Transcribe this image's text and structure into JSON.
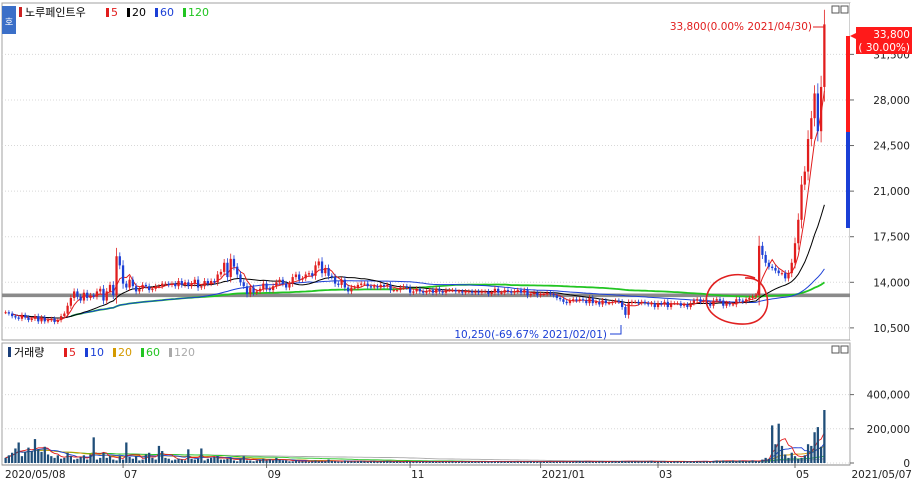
{
  "price_panel": {
    "legend": {
      "stock_name": "노루페인트우",
      "ma_items": [
        {
          "label": "5",
          "color": "#e11d1d"
        },
        {
          "label": "20",
          "color": "#000000"
        },
        {
          "label": "60",
          "color": "#1b3fd6"
        },
        {
          "label": "120",
          "color": "#22c522"
        }
      ]
    },
    "side_tab": "호",
    "y_ticks": [
      "31,500",
      "28,000",
      "24,500",
      "21,000",
      "17,500",
      "14,000",
      "10,500"
    ],
    "current_price_label": {
      "price": "33,800",
      "change": "( 30.00%)",
      "color": "#ff1a1a"
    },
    "high_annotation": "33,800(0.00% 2021/04/30)",
    "low_annotation": "10,250(-69.67% 2021/02/01)",
    "reference_line_value": 13000
  },
  "volume_panel": {
    "legend": {
      "title": "거래량",
      "ma_items": [
        {
          "label": "5",
          "color": "#e11d1d"
        },
        {
          "label": "10",
          "color": "#1b3fd6"
        },
        {
          "label": "20",
          "color": "#d49a00"
        },
        {
          "label": "60",
          "color": "#22c522"
        },
        {
          "label": "120",
          "color": "#aaaaaa"
        }
      ]
    },
    "y_ticks": [
      "400,000",
      "200,000",
      "0"
    ]
  },
  "x_axis": {
    "labels": [
      "2020/05/08",
      "07",
      "09",
      "11",
      "2021/01",
      "03",
      "05",
      "2021/05/07"
    ]
  },
  "chart_data": {
    "type": "candlestick",
    "period": "2020/05/08 - 2021/05/07",
    "price_axis": {
      "ylim": [
        9800,
        34600
      ],
      "ticks": [
        10500,
        14000,
        17500,
        21000,
        24500,
        28000,
        31500
      ]
    },
    "volume_axis": {
      "ylim": [
        0,
        620000
      ],
      "ticks": [
        0,
        200000,
        400000
      ]
    },
    "high": {
      "value": 33800,
      "date": "2021/04/30"
    },
    "low": {
      "value": 10250,
      "date": "2021/02/01"
    },
    "last": {
      "value": 33800,
      "change_pct": 30.0
    },
    "close_series": [
      11700,
      11600,
      11400,
      11300,
      11200,
      11500,
      11300,
      11100,
      11200,
      11400,
      11000,
      11300,
      11000,
      11100,
      11200,
      10950,
      11100,
      11400,
      11600,
      12200,
      12800,
      13300,
      12900,
      12600,
      13200,
      12800,
      13000,
      12900,
      13300,
      13500,
      12600,
      13300,
      13800,
      13000,
      16000,
      15300,
      13900,
      13600,
      14200,
      13700,
      13300,
      13500,
      13800,
      13700,
      13400,
      13500,
      13700,
      13700,
      13900,
      13900,
      13800,
      13900,
      13700,
      14100,
      13800,
      14000,
      13700,
      13900,
      14200,
      13600,
      13700,
      14100,
      13900,
      14100,
      14000,
      14600,
      14800,
      15500,
      14400,
      15800,
      15200,
      14600,
      14000,
      13700,
      13100,
      13600,
      13200,
      13300,
      13500,
      13900,
      13500,
      13400,
      13700,
      14000,
      14200,
      13900,
      13600,
      13900,
      14400,
      14600,
      14200,
      14300,
      14600,
      14700,
      14500,
      15300,
      15600,
      14700,
      15100,
      14500,
      14400,
      13900,
      13800,
      14200,
      13600,
      13300,
      13600,
      13600,
      13800,
      13900,
      13900,
      13700,
      13600,
      13700,
      13600,
      13800,
      13700,
      13800,
      13400,
      13400,
      13400,
      13600,
      13700,
      13600,
      13200,
      13300,
      13500,
      13300,
      13200,
      13300,
      13400,
      13200,
      13500,
      13300,
      13200,
      13400,
      13400,
      13400,
      13300,
      13300,
      13200,
      13300,
      13300,
      13200,
      13300,
      13200,
      13300,
      13300,
      13100,
      13200,
      13500,
      13200,
      13200,
      13400,
      13300,
      13200,
      13300,
      13400,
      13200,
      13400,
      13000,
      13100,
      13200,
      13000,
      13100,
      13100,
      13200,
      13100,
      13000,
      12800,
      12700,
      12500,
      12400,
      12600,
      12700,
      12600,
      12700,
      12600,
      12400,
      12800,
      12400,
      12500,
      12300,
      12600,
      12400,
      12400,
      12500,
      12600,
      12500,
      12100,
      11500,
      12400,
      12500,
      12500,
      12400,
      12500,
      12400,
      12300,
      12400,
      12100,
      12400,
      12300,
      12500,
      12100,
      12400,
      12400,
      12400,
      12200,
      12300,
      12100,
      12400,
      12600,
      12700,
      12500,
      12600,
      12400,
      12200,
      12600,
      12700,
      12600,
      12200,
      12400,
      12300,
      12300,
      12700,
      12600,
      12500,
      12700,
      12800,
      12900,
      13000,
      16800,
      16100,
      15500,
      15200,
      15100,
      14900,
      14700,
      14700,
      14300,
      14700,
      15500,
      17000,
      18800,
      21500,
      22500,
      25000,
      26600,
      28500,
      25600,
      29000,
      33800
    ],
    "volume_series": [
      30000,
      45000,
      60000,
      85000,
      120000,
      40000,
      65000,
      90000,
      70000,
      140000,
      80000,
      65000,
      95000,
      50000,
      40000,
      30000,
      45000,
      25000,
      30000,
      60000,
      40000,
      20000,
      25000,
      35000,
      45000,
      20000,
      50000,
      150000,
      20000,
      30000,
      60000,
      30000,
      40000,
      20000,
      15000,
      40000,
      20000,
      120000,
      35000,
      25000,
      40000,
      15000,
      20000,
      50000,
      60000,
      30000,
      20000,
      100000,
      70000,
      30000,
      25000,
      15000,
      20000,
      25000,
      20000,
      15000,
      80000,
      25000,
      20000,
      25000,
      85000,
      15000,
      25000,
      30000,
      35000,
      40000,
      20000,
      20000,
      25000,
      30000,
      15000,
      10000,
      25000,
      40000,
      15000,
      15000,
      10000,
      15000,
      20000,
      25000,
      15000,
      20000,
      15000,
      30000,
      20000,
      15000,
      15000,
      10000,
      10000,
      15000,
      10000,
      10000,
      10000,
      8000,
      10000,
      15000,
      10000,
      10000,
      10000,
      20000,
      12000,
      10000,
      8000,
      8000,
      15000,
      10000,
      10000,
      10000,
      10000,
      12000,
      10000,
      8000,
      10000,
      10000,
      8000,
      10000,
      10000,
      12000,
      10000,
      8000,
      10000,
      8000,
      8000,
      10000,
      10000,
      8000,
      10000,
      8000,
      10000,
      8000,
      10000,
      10000,
      8000,
      8000,
      10000,
      8000,
      8000,
      10000,
      8000,
      8000,
      8000,
      8000,
      8000,
      8000,
      8000,
      8000,
      8000,
      8000,
      8000,
      8000,
      8000,
      8000,
      8000,
      8000,
      8000,
      8000,
      8000,
      8000,
      8000,
      8000,
      8000,
      10000,
      8000,
      8000,
      8000,
      8000,
      8000,
      8000,
      8000,
      8000,
      8000,
      8000,
      8000,
      8000,
      8000,
      10000,
      12000,
      10000,
      10000,
      10000,
      8000,
      8000,
      10000,
      10000,
      8000,
      8000,
      10000,
      10000,
      10000,
      12000,
      10000,
      10000,
      10000,
      10000,
      10000,
      10000,
      10000,
      10000,
      12000,
      8000,
      8000,
      10000,
      10000,
      8000,
      8000,
      10000,
      10000,
      8000,
      10000,
      10000,
      10000,
      10000,
      10000,
      10000,
      10000,
      10000,
      8000,
      12000,
      15000,
      12000,
      15000,
      10000,
      12000,
      15000,
      10000,
      15000,
      12000,
      10000,
      12000,
      15000,
      12000,
      10000,
      20000,
      30000,
      25000,
      220000,
      110000,
      230000,
      100000,
      50000,
      30000,
      60000,
      40000,
      25000,
      30000,
      45000,
      110000,
      100000,
      180000,
      210000,
      95000,
      310000,
      160000,
      250000,
      170000,
      110000,
      95000,
      150000,
      80000
    ]
  }
}
